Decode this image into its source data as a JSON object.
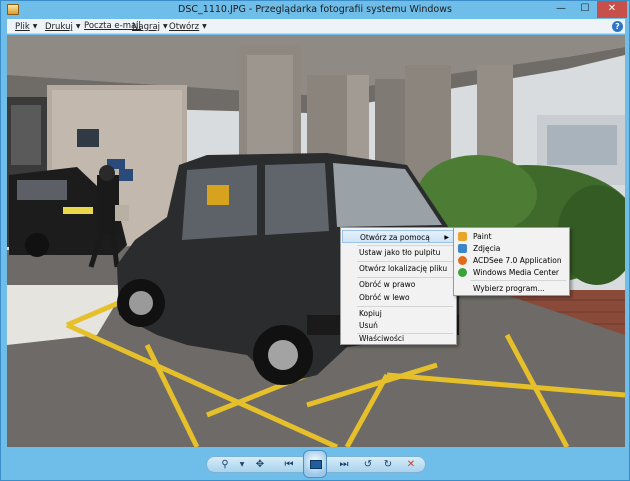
{
  "window": {
    "title": "DSC_1110.JPG - Przeglądarka fotografii systemu Windows",
    "min_glyph": "—",
    "max_glyph": "☐",
    "close_glyph": "✕"
  },
  "menubar": {
    "items": [
      {
        "label": "Plik",
        "icon": "chevron-down-icon"
      },
      {
        "label": "Drukuj",
        "icon": "chevron-down-icon"
      },
      {
        "label": "Poczta e-mail",
        "icon": ""
      },
      {
        "label": "Nagraj",
        "icon": "chevron-down-icon"
      },
      {
        "label": "Otwórz",
        "icon": "chevron-down-icon"
      }
    ],
    "help_glyph": "?"
  },
  "context_menu": {
    "items": [
      {
        "label": "Otwórz za pomocą",
        "highlighted": true,
        "has_submenu": true
      },
      {
        "label": "Ustaw jako tło pulpitu"
      },
      {
        "label": "Otwórz lokalizację pliku"
      },
      {
        "label": "Obróć w prawo"
      },
      {
        "label": "Obróć w lewo"
      },
      {
        "label": "Kopiuj"
      },
      {
        "label": "Usuń"
      },
      {
        "label": "Właściwości"
      }
    ],
    "submenu_arrow": "▶"
  },
  "submenu": {
    "items": [
      {
        "label": "Paint",
        "icon": "paint-icon",
        "color": "#e8a52a"
      },
      {
        "label": "Zdjęcia",
        "icon": "photos-icon",
        "color": "#3a86c8"
      },
      {
        "label": "ACDSee 7.0 Application",
        "icon": "acdsee-icon",
        "color": "#e06b1c"
      },
      {
        "label": "Windows Media Center",
        "icon": "media-center-icon",
        "color": "#3aa23a"
      },
      {
        "label": "Wybierz program...",
        "icon": ""
      }
    ]
  },
  "toolbar": {
    "zoom_glyph": "⚲",
    "fit_glyph": "✥",
    "prev_glyph": "⏮",
    "next_glyph": "⏭",
    "rotate_left_glyph": "↺",
    "rotate_right_glyph": "↻",
    "delete_glyph": "✕"
  },
  "colors": {
    "titlebar": "#6fbde9",
    "close_button": "#c7504a",
    "delete_red": "#d23a2a"
  }
}
